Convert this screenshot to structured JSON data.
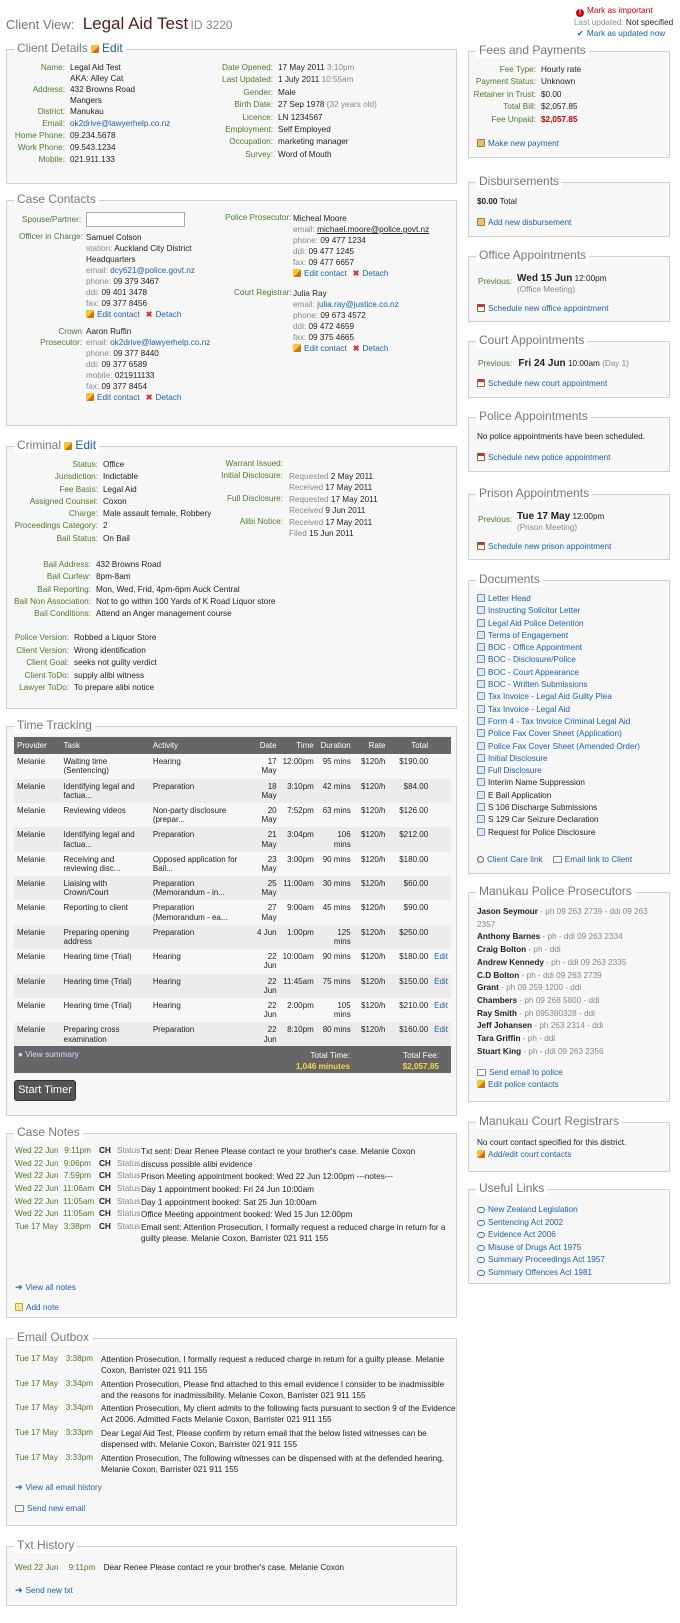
{
  "header": {
    "prefix": "Client View:",
    "client_name": "Legal Aid Test",
    "client_id": "ID 3220",
    "mark_important": "Mark as important",
    "last_updated_label": "Last updated:",
    "last_updated_value": "Not specified",
    "mark_updated_now": "Mark as updated now"
  },
  "client_details": {
    "title": "Client Details",
    "edit": "Edit",
    "left": [
      {
        "label": "Name:",
        "lines": [
          "Legal Aid Test",
          "AKA: Alley Cat"
        ]
      },
      {
        "label": "Address:",
        "lines": [
          "432 Browns Road",
          "Mangers"
        ]
      },
      {
        "label": "District:",
        "lines": [
          "Manukau"
        ]
      },
      {
        "label": "Email:",
        "lines": [
          "ok2drive@lawyerhelp.co.nz"
        ]
      },
      {
        "label": "Home Phone:",
        "lines": [
          "09.234.5678"
        ]
      },
      {
        "label": "Work Phone:",
        "lines": [
          "09.543.1234"
        ]
      },
      {
        "label": "Mobile:",
        "lines": [
          "021.911.133"
        ]
      }
    ],
    "right": [
      {
        "label": "Date Opened:",
        "value": "17 May 2011",
        "extra": "3:10pm"
      },
      {
        "label": "Last Updated:",
        "value": "1 July 2011",
        "extra": "10:55am"
      },
      {
        "label": "Gender:",
        "value": "Male",
        "extra": ""
      },
      {
        "label": "Birth Date:",
        "value": "27 Sep 1978",
        "extra": "(32 years old)"
      },
      {
        "label": "Licence:",
        "value": "LN 1234567",
        "extra": ""
      },
      {
        "label": "Employment:",
        "value": "Self Employed",
        "extra": ""
      },
      {
        "label": "Occupation:",
        "value": "marketing manager",
        "extra": ""
      },
      {
        "label": "Survey:",
        "value": "Word of Mouth",
        "extra": ""
      }
    ]
  },
  "case_contacts": {
    "title": "Case Contacts",
    "spouse_label": "Spouse/Partner:",
    "officer_label": "Officer in Charge:",
    "officer": {
      "name": "Samuel Colson",
      "station_label": "station:",
      "station": "Auckland City District",
      "station2": "Headquarters",
      "email_label": "email:",
      "email": "dcy621@police.govt.nz",
      "phone_label": "phone:",
      "phone": "09 379 3467",
      "ddi_label": "ddi:",
      "ddi": "09 401 3478",
      "fax_label": "fax:",
      "fax": "09 377 8456"
    },
    "crown_label1": "Crown",
    "crown_label2": "Prosecutor:",
    "crown": {
      "name": "Aaron Ruffin",
      "email_label": "email:",
      "email": "ok2drive@lawyerhelp.co.nz",
      "phone_label": "phone:",
      "phone": "09 377 8440",
      "ddi_label": "ddi:",
      "ddi": "09 377 6589",
      "mobile_label": "mobile:",
      "mobile": "021911133",
      "fax_label": "fax:",
      "fax": "09 377 8454"
    },
    "police_label": "Police Prosecutor:",
    "police": {
      "name": "Micheal Moore",
      "email_label": "email:",
      "email": "michael.moore@police.govt.nz",
      "phone_label": "phone:",
      "phone": "09 477 1234",
      "ddi_label": "ddi:",
      "ddi": "09 477 1245",
      "fax_label": "fax:",
      "fax": "09 477 6657"
    },
    "registrar_label": "Court Registrar:",
    "registrar": {
      "name": "Julia Ray",
      "email_label": "email:",
      "email": "julia.ray@justice.co.nz",
      "phone_label": "phone:",
      "phone": "09 673 4572",
      "ddi_label": "ddi:",
      "ddi": "09 472 4659",
      "fax_label": "fax:",
      "fax": "09 375 4665"
    },
    "edit_contact": "Edit contact",
    "detach": "Detach"
  },
  "criminal": {
    "title": "Criminal",
    "edit": "Edit",
    "left": [
      {
        "label": "Status:",
        "value": "Office"
      },
      {
        "label": "Jurisdiction:",
        "value": "Indictable"
      },
      {
        "label": "Fee Basis:",
        "value": "Legal Aid"
      },
      {
        "label": "Assigned Counsel:",
        "value": "Coxon"
      },
      {
        "label": "Charge:",
        "value": "Male assault female, Robbery"
      },
      {
        "label": "Proceedings Category:",
        "value": "2"
      },
      {
        "label": "Bail Status:",
        "value": "On Bail"
      }
    ],
    "warrant_label": "Warrant Issued:",
    "initial_label": "Initial Disclosure:",
    "initial": [
      {
        "k": "Requested",
        "v": "2 May 2011"
      },
      {
        "k": "Received",
        "v": "17 May 2011"
      }
    ],
    "full_label": "Full Disclosure:",
    "full": [
      {
        "k": "Requested",
        "v": "17 May 2011"
      },
      {
        "k": "Received",
        "v": "9 Jun 2011"
      }
    ],
    "alibi_label": "Alibi Notice:",
    "alibi": [
      {
        "k": "Received",
        "v": "17 May 2011"
      },
      {
        "k": "Filed",
        "v": "15 Jun 2011"
      }
    ],
    "bail": [
      {
        "label": "Bail Address:",
        "value": "432 Browns Road"
      },
      {
        "label": "Bail Curfew:",
        "value": "8pm-8am"
      },
      {
        "label": "Bail Reporting:",
        "value": "Mon, Wed, Frid, 4pm-6pm Auck Central"
      },
      {
        "label": "Bail Non Association:",
        "value": "Not to go within 100 Yards of K Road Liquor store"
      },
      {
        "label": "Bail Conditions:",
        "value": "Attend an Anger management course"
      }
    ],
    "versions": [
      {
        "label": "Police Version:",
        "value": "Robbed a Liquor Store"
      },
      {
        "label": "Client Version:",
        "value": "Wrong identification"
      },
      {
        "label": "Client Goal:",
        "value": "seeks not guilty verdict"
      },
      {
        "label": "Client ToDo:",
        "value": "supply alibi witness"
      },
      {
        "label": "Lawyer ToDo:",
        "value": "To prepare alibi notice"
      }
    ]
  },
  "time_tracking": {
    "title": "Time Tracking",
    "columns": [
      "Provider",
      "Task",
      "Activity",
      "Date",
      "Time",
      "Duration",
      "Rate",
      "Total"
    ],
    "rows": [
      {
        "provider": "Melanie",
        "task": [
          "Waiting time",
          "(Sentencing)"
        ],
        "activity": [
          "Hearing"
        ],
        "date": [
          "17",
          "May"
        ],
        "time": "12:00pm",
        "duration": [
          "95 mins"
        ],
        "rate": "$120/h",
        "total": "$190.00",
        "edit": ""
      },
      {
        "provider": "Melanie",
        "task": [
          "Identifying legal and",
          "factua..."
        ],
        "activity": [
          "Preparation"
        ],
        "date": [
          "18",
          "May"
        ],
        "time": "3:10pm",
        "duration": [
          "42 mins"
        ],
        "rate": "$120/h",
        "total": "$84.00",
        "edit": ""
      },
      {
        "provider": "Melanie",
        "task": [
          "Reviewing videos"
        ],
        "activity": [
          "Non-party disclosure",
          "(prepar..."
        ],
        "date": [
          "20",
          "May"
        ],
        "time": "7:52pm",
        "duration": [
          "63 mins"
        ],
        "rate": "$120/h",
        "total": "$126.00",
        "edit": ""
      },
      {
        "provider": "Melanie",
        "task": [
          "Identifying legal and",
          "factua..."
        ],
        "activity": [
          "Preparation"
        ],
        "date": [
          "21",
          "May"
        ],
        "time": "3:04pm",
        "duration": [
          "106",
          "mins"
        ],
        "rate": "$120/h",
        "total": "$212.00",
        "edit": ""
      },
      {
        "provider": "Melanie",
        "task": [
          "Receiving and",
          "reviewing disc..."
        ],
        "activity": [
          "Opposed application for",
          "Bail..."
        ],
        "date": [
          "23",
          "May"
        ],
        "time": "3:00pm",
        "duration": [
          "90 mins"
        ],
        "rate": "$120/h",
        "total": "$180.00",
        "edit": ""
      },
      {
        "provider": "Melanie",
        "task": [
          "Liaising with",
          "Crown/Court"
        ],
        "activity": [
          "Preparation",
          "(Memorandum - in..."
        ],
        "date": [
          "25",
          "May"
        ],
        "time": "11:00am",
        "duration": [
          "30 mins"
        ],
        "rate": "$120/h",
        "total": "$60.00",
        "edit": ""
      },
      {
        "provider": "Melanie",
        "task": [
          "Reporting to client"
        ],
        "activity": [
          "Preparation",
          "(Memorandum - ea..."
        ],
        "date": [
          "27",
          "May"
        ],
        "time": "9:00am",
        "duration": [
          "45 mins"
        ],
        "rate": "$120/h",
        "total": "$90.00",
        "edit": ""
      },
      {
        "provider": "Melanie",
        "task": [
          "Preparing opening",
          "address"
        ],
        "activity": [
          "Preparation"
        ],
        "date": [
          "4 Jun"
        ],
        "time": "1:00pm",
        "duration": [
          "125",
          "mins"
        ],
        "rate": "$120/h",
        "total": "$250.00",
        "edit": ""
      },
      {
        "provider": "Melanie",
        "task": [
          "Hearing time (Trial)"
        ],
        "activity": [
          "Hearing"
        ],
        "date": [
          "22",
          "Jun"
        ],
        "time": "10:00am",
        "duration": [
          "90 mins"
        ],
        "rate": "$120/h",
        "total": "$180.00",
        "edit": "Edit"
      },
      {
        "provider": "Melanie",
        "task": [
          "Hearing time (Trial)"
        ],
        "activity": [
          "Hearing"
        ],
        "date": [
          "22",
          "Jun"
        ],
        "time": "11:45am",
        "duration": [
          "75 mins"
        ],
        "rate": "$120/h",
        "total": "$150.00",
        "edit": "Edit"
      },
      {
        "provider": "Melanie",
        "task": [
          "Hearing time (Trial)"
        ],
        "activity": [
          "Hearing"
        ],
        "date": [
          "22",
          "Jun"
        ],
        "time": "2:00pm",
        "duration": [
          "105",
          "mins"
        ],
        "rate": "$120/h",
        "total": "$210.00",
        "edit": "Edit"
      },
      {
        "provider": "Melanie",
        "task": [
          "Preparing cross",
          "examination"
        ],
        "activity": [
          "Preparation"
        ],
        "date": [
          "22",
          "Jun"
        ],
        "time": "8:10pm",
        "duration": [
          "80 mins"
        ],
        "rate": "$120/h",
        "total": "$160.00",
        "edit": "Edit"
      }
    ],
    "view_summary": "View summary",
    "total_time_label": "Total Time:",
    "total_time": "1,046 minutes",
    "total_fee_label": "Total Fee:",
    "total_fee": "$2,057.85",
    "start_timer": "Start Timer"
  },
  "case_notes": {
    "title": "Case Notes",
    "notes": [
      {
        "date": "Wed 22 Jun",
        "time": "9:11pm",
        "who": "CH",
        "type": "Status",
        "text": [
          "Txt sent: Dear Renee Please contact re your brother's case. Melanie Coxon"
        ]
      },
      {
        "date": "Wed 22 Jun",
        "time": "9:06pm",
        "who": "CH",
        "type": "Status",
        "text": [
          "discuss possible alibi evidence"
        ]
      },
      {
        "date": "Wed 22 Jun",
        "time": "7:59pm",
        "who": "CH",
        "type": "Status",
        "text": [
          "Prison Meeting appointment booked: Wed 22 Jun 12:00pm ---notes---"
        ]
      },
      {
        "date": "Wed 22 Jun",
        "time": "11:06am",
        "who": "CH",
        "type": "Status",
        "text": [
          "Day 1 appointment booked: Fri 24 Jun 10:00am"
        ]
      },
      {
        "date": "Wed 22 Jun",
        "time": "11:05am",
        "who": "CH",
        "type": "Status",
        "text": [
          "Day 1 appointment booked: Sat 25 Jun 10:00am"
        ]
      },
      {
        "date": "Wed 22 Jun",
        "time": "11:05am",
        "who": "CH",
        "type": "Status",
        "text": [
          "Office Meeting appointment booked: Wed 15 Jun 12:00pm"
        ]
      },
      {
        "date": "Tue 17 May",
        "time": "3:38pm",
        "who": "CH",
        "type": "Status",
        "text": [
          "Email sent: Attention Prosecution, I formally request a reduced charge in return for a",
          "guilty please. Melanie Coxon, Barrister 021 911 155"
        ]
      }
    ],
    "view_all": "View all notes",
    "add_note": "Add note"
  },
  "email_outbox": {
    "title": "Email Outbox",
    "emails": [
      {
        "date": "Tue 17 May",
        "time": "3:38pm",
        "text": [
          "Attention Prosecution, I formally request a reduced charge in return for a guilty please. Melanie",
          "Coxon, Barrister 021 911 155"
        ]
      },
      {
        "date": "Tue 17 May",
        "time": "3:34pm",
        "text": [
          "Attention Prosecution, Please find attached to this email evidence I consider to be inadmissible",
          "and the reasons for inadmissibility. Melanie Coxon, Barrister 021 911 155"
        ]
      },
      {
        "date": "Tue 17 May",
        "time": "3:34pm",
        "text": [
          "Attention Prosecution, My client admits to the following facts pursuant to section 9 of the Evidence",
          "Act 2006. Admitted Facts Melanie Coxon, Barrister 021 911 155"
        ]
      },
      {
        "date": "Tue 17 May",
        "time": "3:33pm",
        "text": [
          "Dear Legal Aid Test, Please confirm by return email that the below listed witnesses can be",
          "dispensed with. Melanie Coxon, Barrister 021 911 155"
        ]
      },
      {
        "date": "Tue 17 May",
        "time": "3:33pm",
        "text": [
          "Attention Prosecution, The following witnesses can be dispensed with at the defended hearing.",
          "Melanie Coxon, Barrister 021 911 155"
        ]
      }
    ],
    "view_all": "View all email history",
    "send_new": "Send new email"
  },
  "txt_history": {
    "title": "Txt History",
    "items": [
      {
        "date": "Wed 22 Jun",
        "time": "9:11pm",
        "text": "Dear Renee Please contact re your brother's case. Melanie Coxon"
      }
    ],
    "send_new": "Send new txt"
  },
  "fees": {
    "title": "Fees and Payments",
    "rows": [
      {
        "label": "Fee Type:",
        "value": "Hourly rate"
      },
      {
        "label": "Payment Status:",
        "value": "Unknown"
      },
      {
        "label": "Retainer in Trust:",
        "value": "$0.00"
      },
      {
        "label": "Total Bill:",
        "value": "$2,057.85"
      },
      {
        "label": "Fee Unpaid:",
        "value": "$2,057.85"
      }
    ],
    "make_payment": "Make new payment"
  },
  "disbursements": {
    "title": "Disbursements",
    "total_value": "$0.00",
    "total_label": "Total",
    "add": "Add new disbursement"
  },
  "office_appts": {
    "title": "Office Appointments",
    "prev_label": "Previous:",
    "date": "Wed 15 Jun",
    "time": "12:00pm",
    "sub": "(Office Meeting)",
    "schedule": "Schedule new office appointment"
  },
  "court_appts": {
    "title": "Court Appointments",
    "prev_label": "Previous:",
    "date": "Fri 24 Jun",
    "time": "10:00am",
    "sub": "(Day 1)",
    "schedule": "Schedule new court appointment"
  },
  "police_appts": {
    "title": "Police Appointments",
    "none": "No police appointments have been scheduled.",
    "schedule": "Schedule new police appointment"
  },
  "prison_appts": {
    "title": "Prison Appointments",
    "prev_label": "Previous:",
    "date": "Tue 17 May",
    "time": "12:00pm",
    "sub": "(Prison Meeting)",
    "schedule": "Schedule new prison appointment"
  },
  "documents": {
    "title": "Documents",
    "links": [
      "Letter Head",
      "Instructing Solicitor Letter",
      "Legal Aid Police Detention",
      "Terms of Engagement",
      "BOC - Office Appointment",
      "BOC - Disclosure/Police",
      "BOC - Court Appearance",
      "BOC - Written Submissions",
      "Tax Invoice - Legal Aid Guilty Plea",
      "Tax Invoice - Legal Aid",
      "Form 4 - Tax Invoice Criminal Legal Aid",
      "Police Fax Cover Sheet (Application)",
      "Police Fax Cover Sheet (Amended Order)",
      "Initial Disclosure",
      "Full Disclosure"
    ],
    "plain": [
      "Interim Name Suppression",
      "E Bail Application",
      "S 106 Discharge Submissions",
      "S 129 Car Seizure Declaration",
      "Request for Police Disclosure"
    ],
    "client_care": "Client Care link",
    "email_link": "Email link to Client"
  },
  "prosecutors": {
    "title": "Manukau Police Prosecutors",
    "people": [
      {
        "name": "Jason Seymour",
        "info": " - ph 09 263 2739 - ddi 09 263",
        "info2": "2357"
      },
      {
        "name": "Anthony Barnes",
        "info": " - ph - ddi 09 263 2334",
        "info2": ""
      },
      {
        "name": "Craig Bolton",
        "info": " - ph - ddi",
        "info2": ""
      },
      {
        "name": "Andrew Kennedy",
        "info": " - ph - ddi 09 263 2335",
        "info2": ""
      },
      {
        "name": "C.D Bolton",
        "info": " - ph - ddi 09 263 2739",
        "info2": ""
      },
      {
        "name": "Grant",
        "info": " - ph 09 259 1200 - ddi",
        "info2": ""
      },
      {
        "name": "Chambers",
        "info": " - ph 09 268 5800 - ddi",
        "info2": ""
      },
      {
        "name": "Ray Smith",
        "info": " - ph 095380328 - ddi",
        "info2": ""
      },
      {
        "name": "Jeff Johansen",
        "info": " - ph 263 2314 - ddi",
        "info2": ""
      },
      {
        "name": "Tara Griffin",
        "info": " - ph - ddi",
        "info2": ""
      },
      {
        "name": "Stuart King",
        "info": " - ph - ddi 09 263 2356",
        "info2": ""
      }
    ],
    "send_email": "Send email to police",
    "edit_contacts": "Edit police contacts"
  },
  "registrars": {
    "title": "Manukau Court Registrars",
    "none": "No court contact specified for this district.",
    "add": "Add/edit court contacts"
  },
  "useful_links": {
    "title": "Useful Links",
    "links": [
      "New Zealand Legislation",
      "Sentencing Act 2002",
      "Evidence Act 2006",
      "Misuse of Drugs Act 1975",
      "Summary Proceedings Act 1957",
      "Summary Offences Act 1981"
    ]
  }
}
